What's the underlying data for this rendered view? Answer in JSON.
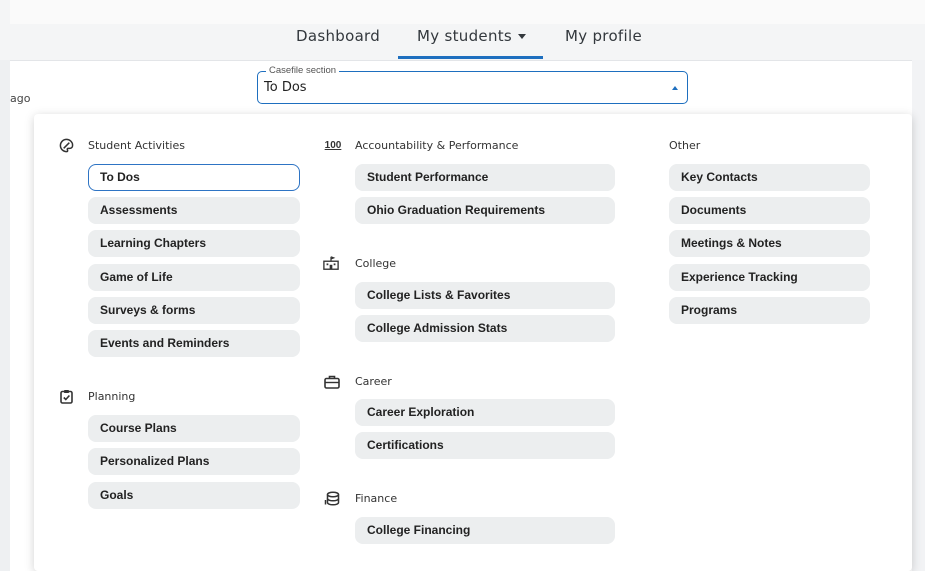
{
  "nav": {
    "dashboard": "Dashboard",
    "my_students": "My students",
    "my_profile": "My profile"
  },
  "background_text": "ago",
  "casefile": {
    "label": "Casefile section",
    "value": "To Dos"
  },
  "groups": {
    "student_activities": {
      "title": "Student Activities",
      "icon": "palette-icon",
      "items": [
        "To Dos",
        "Assessments",
        "Learning Chapters",
        "Game of Life",
        "Surveys & forms",
        "Events and Reminders"
      ]
    },
    "planning": {
      "title": "Planning",
      "icon": "clipboard-check-icon",
      "items": [
        "Course Plans",
        "Personalized Plans",
        "Goals"
      ]
    },
    "accountability": {
      "title": "Accountability & Performance",
      "icon": "100-icon",
      "items": [
        "Student Performance",
        "Ohio Graduation Requirements"
      ]
    },
    "college": {
      "title": "College",
      "icon": "school-icon",
      "items": [
        "College Lists & Favorites",
        "College Admission Stats"
      ]
    },
    "career": {
      "title": "Career",
      "icon": "briefcase-icon",
      "items": [
        "Career Exploration",
        "Certifications"
      ]
    },
    "finance": {
      "title": "Finance",
      "icon": "coins-icon",
      "items": [
        "College Financing"
      ]
    },
    "other": {
      "title": "Other",
      "items": [
        "Key Contacts",
        "Documents",
        "Meetings & Notes",
        "Experience Tracking",
        "Programs"
      ]
    }
  },
  "colors": {
    "accent": "#1e6fbf",
    "chip_bg": "#eceeef"
  }
}
